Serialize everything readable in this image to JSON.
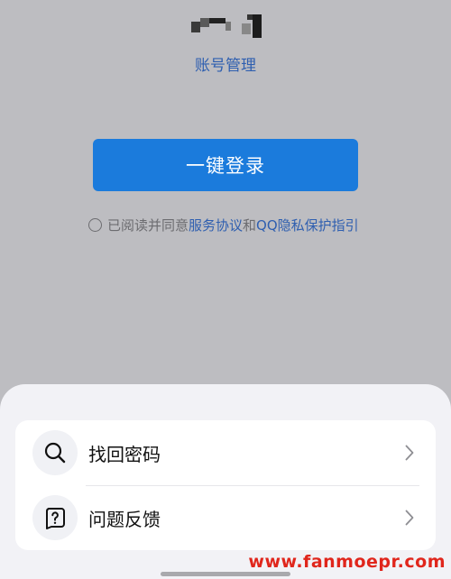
{
  "header": {
    "account_manage": "账号管理"
  },
  "login": {
    "button_label": "一键登录"
  },
  "agreement": {
    "prefix": "已阅读并同意",
    "service_link": "服务协议",
    "and": "和",
    "privacy_link": "QQ隐私保护指引"
  },
  "menu": {
    "items": [
      {
        "label": "找回密码",
        "icon": "search-icon"
      },
      {
        "label": "问题反馈",
        "icon": "question-box-icon"
      }
    ]
  },
  "watermark": "www.fanmoepr.com",
  "colors": {
    "accent": "#1b7bdc",
    "link": "#2f5fb0",
    "background": "#bdbdc1",
    "sheet": "#f2f2f6"
  }
}
